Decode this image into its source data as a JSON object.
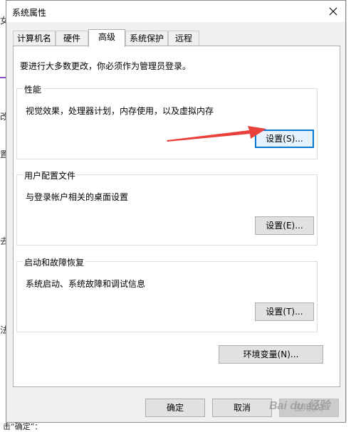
{
  "window": {
    "title": "系统属性"
  },
  "tabs": [
    {
      "label": "计算机名"
    },
    {
      "label": "硬件"
    },
    {
      "label": "高级"
    },
    {
      "label": "系统保护"
    },
    {
      "label": "远程"
    }
  ],
  "active_tab": "高级",
  "intro": "要进行大多数更改，你必须作为管理员登录。",
  "performance": {
    "title": "性能",
    "desc": "视觉效果，处理器计划，内存使用，以及虚拟内存",
    "button": "设置(S)..."
  },
  "profile": {
    "title": "用户配置文件",
    "desc": "与登录帐户相关的桌面设置",
    "button": "设置(E)..."
  },
  "startup": {
    "title": "启动和故障恢复",
    "desc": "系统启动、系统故障和调试信息",
    "button": "设置(T)..."
  },
  "env_button": "环境变量(N)...",
  "footer": {
    "ok": "确定",
    "cancel": "取消",
    "apply": "应用(A)"
  },
  "background": {
    "left_chars": [
      "女",
      "改",
      "置",
      "去",
      "法"
    ],
    "bottom_text": "击“确定”："
  },
  "watermark": "Bai du 经验",
  "colors": {
    "accent": "#0078d7",
    "arrow": "#e8403a"
  }
}
